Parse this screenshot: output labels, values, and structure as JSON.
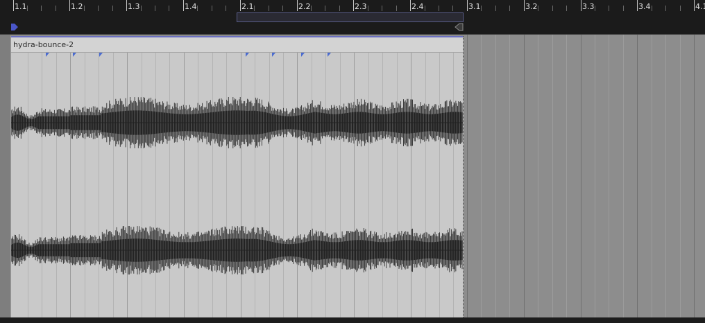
{
  "ruler": {
    "bar_labels": [
      "1.1",
      "1.2",
      "1.3",
      "1.4",
      "2.1",
      "2.2",
      "2.3",
      "2.4",
      "3.1",
      "3.2",
      "3.3",
      "3.4",
      "4.1"
    ]
  },
  "clip": {
    "name": "hydra-bounce-2"
  },
  "colors": {
    "ruler_bg": "#1b1b1b",
    "loop_region_border": "#5a5f8c",
    "clip_bg": "#c9c9c9",
    "clip_accent": "#6a6fc0",
    "marker": "#4a6bd0",
    "waveform": "#2e2e2e",
    "empty_lane": "#8d8d8d"
  },
  "icons": {
    "start_marker": "playhead-start-marker-icon",
    "end_marker": "loop-end-marker-icon",
    "transient_marker": "transient-marker-icon"
  }
}
